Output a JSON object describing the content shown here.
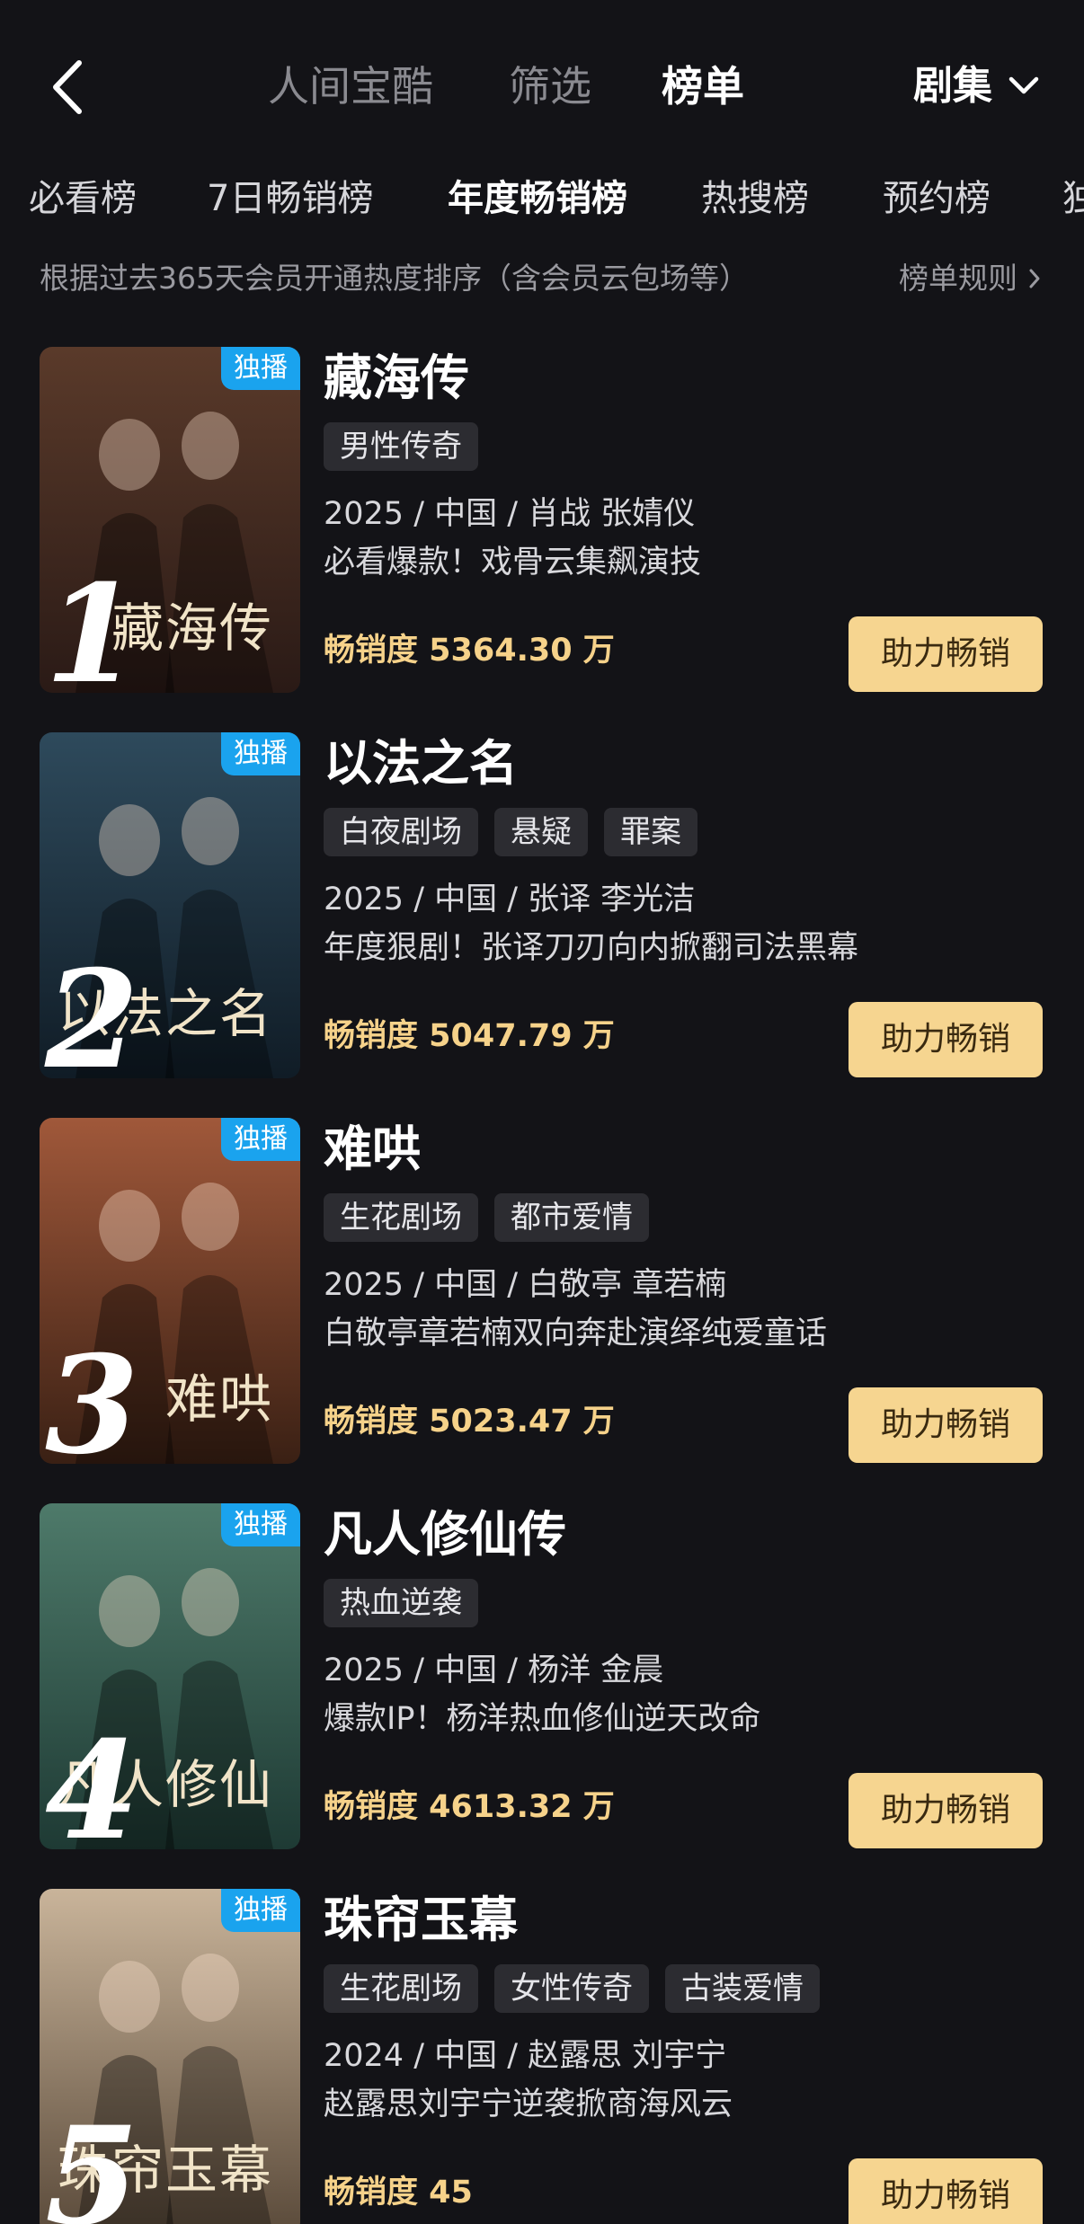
{
  "nav": {
    "tabs": [
      "人间宝酷",
      "筛选",
      "榜单"
    ],
    "active_tab": "榜单",
    "genre_dropdown": "剧集"
  },
  "subtabs": [
    "必看榜",
    "7日畅销榜",
    "年度畅销榜",
    "热搜榜",
    "预约榜",
    "独"
  ],
  "active_subtab": "年度畅销榜",
  "rule": {
    "description": "根据过去365天会员开通热度排序（含会员云包场等）",
    "link": "榜单规则"
  },
  "items": [
    {
      "rank": "1",
      "badge": "独播",
      "title": "藏海传",
      "poster_text": "藏海传",
      "tags": [
        "男性传奇"
      ],
      "meta": "2025 / 中国 / 肖战 张婧仪",
      "desc": "必看爆款！戏骨云集飙演技",
      "sales": "畅销度 5364.30 万",
      "button": "助力畅销",
      "colors": [
        "#5a3a2a",
        "#2a1a16"
      ]
    },
    {
      "rank": "2",
      "badge": "独播",
      "title": "以法之名",
      "poster_text": "以法之名",
      "tags": [
        "白夜剧场",
        "悬疑",
        "罪案"
      ],
      "meta": "2025 / 中国 / 张译 李光洁",
      "desc": "年度狠剧！张译刀刃向内掀翻司法黑幕",
      "sales": "畅销度 5047.79 万",
      "button": "助力畅销",
      "colors": [
        "#2e4a5c",
        "#101c26"
      ]
    },
    {
      "rank": "3",
      "badge": "独播",
      "title": "难哄",
      "poster_text": "难哄",
      "tags": [
        "生花剧场",
        "都市爱情"
      ],
      "meta": "2025 / 中国 / 白敬亭 章若楠",
      "desc": "白敬亭章若楠双向奔赴演绎纯爱童话",
      "sales": "畅销度 5023.47 万",
      "button": "助力畅销",
      "colors": [
        "#a0583a",
        "#3a2014"
      ]
    },
    {
      "rank": "4",
      "badge": "独播",
      "title": "凡人修仙传",
      "poster_text": "凡人修仙",
      "tags": [
        "热血逆袭"
      ],
      "meta": "2025 / 中国 / 杨洋 金晨",
      "desc": "爆款IP！杨洋热血修仙逆天改命",
      "sales": "畅销度 4613.32 万",
      "button": "助力畅销",
      "colors": [
        "#4e7a6a",
        "#1e3a34"
      ]
    },
    {
      "rank": "5",
      "badge": "独播",
      "title": "珠帘玉幕",
      "poster_text": "珠帘玉幕",
      "tags": [
        "生花剧场",
        "女性传奇",
        "古装爱情"
      ],
      "meta": "2024 / 中国 / 赵露思 刘宇宁",
      "desc": "赵露思刘宇宁逆袭掀商海风云",
      "sales": "畅销度 45",
      "button": "助力畅销",
      "colors": [
        "#c9b49a",
        "#5a4a3a"
      ]
    }
  ]
}
